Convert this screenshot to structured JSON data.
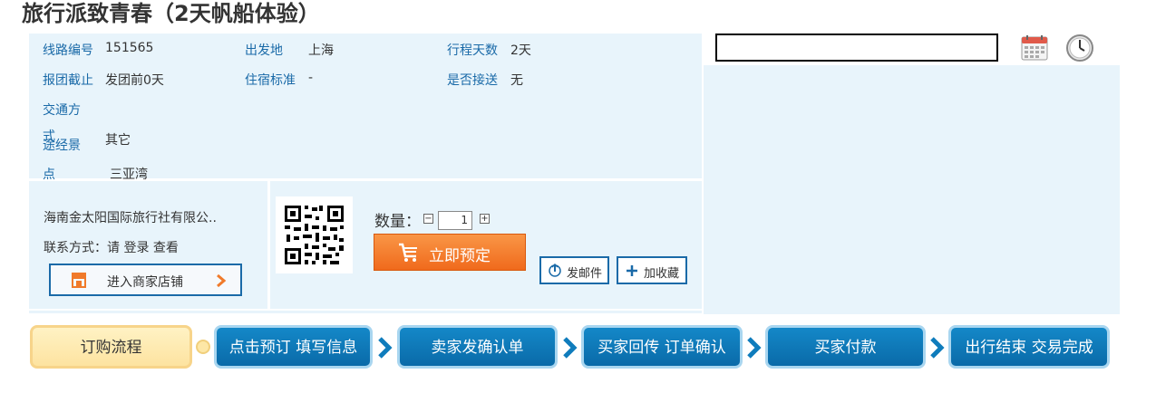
{
  "title": "旅行派致青春（2天帆船体验）",
  "info": {
    "route_no_label": "线路编号",
    "route_no": "151565",
    "depart_label": "出发地",
    "depart": "上海",
    "days_label": "行程天数",
    "days": "2天",
    "deadline_label": "报团截止",
    "deadline": "发团前0天",
    "hotel_label": "住宿标准",
    "hotel": "-",
    "pickup_label": "是否接送",
    "pickup": "无",
    "transport_label_1": "交通方",
    "transport_label_2": "式",
    "transport": "其它",
    "scenic_label_1": "途经景",
    "scenic_label_2": "点",
    "scenic": "三亚湾"
  },
  "seller": {
    "name": "海南金太阳国际旅行社有限公..",
    "contact_label": "联系方式：请",
    "login": "登录",
    "view": "查看",
    "store_button": "进入商家店铺"
  },
  "order": {
    "quantity_label": "数量：",
    "minus": "−",
    "quantity": "1",
    "plus": "+",
    "book_button": "立即预定",
    "email_button": "发邮件",
    "favorite_button": "加收藏"
  },
  "date_picker": {
    "value": "",
    "calendar_icon": "calendar-icon",
    "clock_icon": "clock-icon"
  },
  "steps": {
    "title": "订购流程",
    "items": [
      "点击预订 填写信息",
      "卖家发确认单",
      "买家回传 订单确认",
      "买家付款",
      "出行结束 交易完成"
    ]
  },
  "colors": {
    "label_blue": "#1a6aa8",
    "panel_bg": "#e8f4fb",
    "book_orange": "#f28030",
    "step_blue": "#0f7cbc",
    "step_yellow": "#fde7a6"
  }
}
